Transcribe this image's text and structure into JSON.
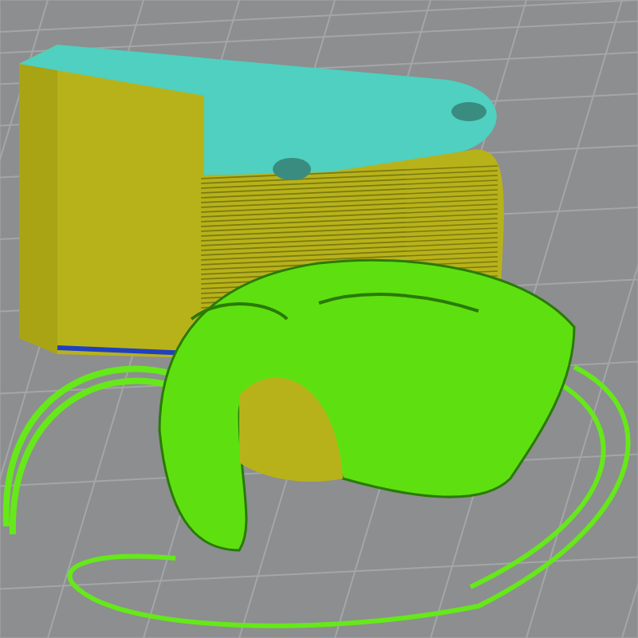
{
  "viewport": {
    "kind": "layer-preview"
  }
}
